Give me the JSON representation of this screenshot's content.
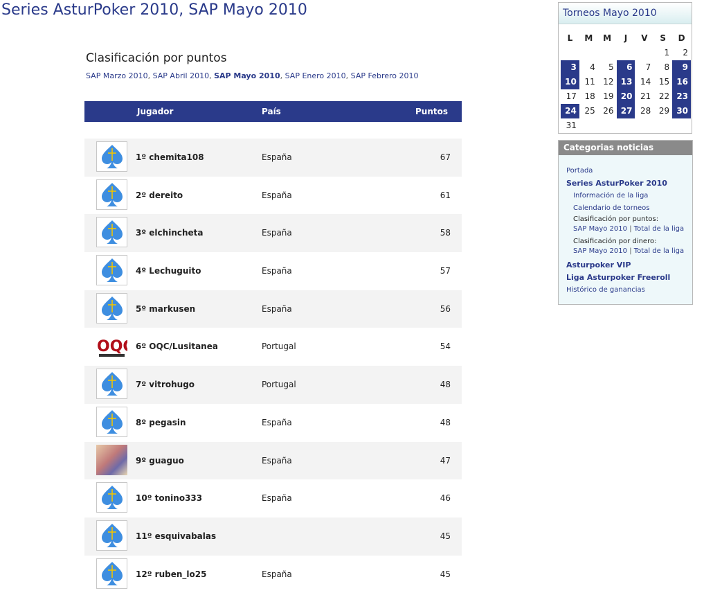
{
  "page_title": "Series AsturPoker 2010, SAP Mayo 2010",
  "section": {
    "title": "Clasificación por puntos",
    "links": [
      {
        "label": "SAP Marzo 2010",
        "current": false
      },
      {
        "label": "SAP Abril 2010",
        "current": false
      },
      {
        "label": "SAP Mayo 2010",
        "current": true
      },
      {
        "label": "SAP Enero 2010",
        "current": false
      },
      {
        "label": "SAP Febrero 2010",
        "current": false
      }
    ],
    "link_separator": ", "
  },
  "table": {
    "headers": {
      "player": "Jugador",
      "country": "País",
      "points": "Puntos"
    },
    "rows": [
      {
        "name": "1º chemita108",
        "country": "España",
        "points": "67",
        "avatar": "spade-icon"
      },
      {
        "name": "2º dereito",
        "country": "España",
        "points": "61",
        "avatar": "spade-icon"
      },
      {
        "name": "3º elchincheta",
        "country": "España",
        "points": "58",
        "avatar": "spade-icon"
      },
      {
        "name": "4º Lechuguito",
        "country": "España",
        "points": "57",
        "avatar": "spade-icon"
      },
      {
        "name": "5º markusen",
        "country": "España",
        "points": "56",
        "avatar": "spade-icon"
      },
      {
        "name": "6º OQC/Lusitanea",
        "country": "Portugal",
        "points": "54",
        "avatar": "oqc-logo"
      },
      {
        "name": "7º vitrohugo",
        "country": "Portugal",
        "points": "48",
        "avatar": "spade-icon"
      },
      {
        "name": "8º pegasin",
        "country": "España",
        "points": "48",
        "avatar": "spade-icon"
      },
      {
        "name": "9º guaguo",
        "country": "España",
        "points": "47",
        "avatar": "photo-avatar"
      },
      {
        "name": "10º tonino333",
        "country": "España",
        "points": "46",
        "avatar": "spade-icon"
      },
      {
        "name": "11º esquivabalas",
        "country": "",
        "points": "45",
        "avatar": "spade-icon"
      },
      {
        "name": "12º ruben_lo25",
        "country": "España",
        "points": "45",
        "avatar": "spade-icon"
      }
    ]
  },
  "calendar": {
    "title": "Torneos Mayo 2010",
    "weekdays": [
      "L",
      "M",
      "M",
      "J",
      "V",
      "S",
      "D"
    ],
    "weeks": [
      [
        {
          "d": ""
        },
        {
          "d": ""
        },
        {
          "d": ""
        },
        {
          "d": ""
        },
        {
          "d": ""
        },
        {
          "d": "1"
        },
        {
          "d": "2"
        }
      ],
      [
        {
          "d": "3",
          "hi": true
        },
        {
          "d": "4"
        },
        {
          "d": "5"
        },
        {
          "d": "6",
          "hi": true
        },
        {
          "d": "7"
        },
        {
          "d": "8"
        },
        {
          "d": "9",
          "hi": true
        }
      ],
      [
        {
          "d": "10",
          "hi": true
        },
        {
          "d": "11"
        },
        {
          "d": "12"
        },
        {
          "d": "13",
          "hi": true
        },
        {
          "d": "14"
        },
        {
          "d": "15"
        },
        {
          "d": "16",
          "hi": true
        }
      ],
      [
        {
          "d": "17"
        },
        {
          "d": "18"
        },
        {
          "d": "19"
        },
        {
          "d": "20",
          "hi": true
        },
        {
          "d": "21"
        },
        {
          "d": "22"
        },
        {
          "d": "23",
          "hi": true
        }
      ],
      [
        {
          "d": "24",
          "hi": true
        },
        {
          "d": "25"
        },
        {
          "d": "26"
        },
        {
          "d": "27",
          "hi": true
        },
        {
          "d": "28"
        },
        {
          "d": "29"
        },
        {
          "d": "30",
          "hi": true
        }
      ],
      [
        {
          "d": "31"
        },
        {
          "d": ""
        },
        {
          "d": ""
        },
        {
          "d": ""
        },
        {
          "d": ""
        },
        {
          "d": ""
        },
        {
          "d": ""
        }
      ]
    ]
  },
  "categories": {
    "title": "Categorias noticias",
    "portada": "Portada",
    "series": "Series AsturPoker 2010",
    "info_liga": "Información de la liga",
    "calendario": "Calendario de torneos",
    "clasif_puntos": "Clasificación por puntos:",
    "clasif_dinero": "Clasificación por dinero:",
    "sap_mayo": "SAP Mayo 2010",
    "total_liga": "Total de la liga",
    "sep": " | ",
    "vip": "Asturpoker VIP",
    "freeroll": "Liga Asturpoker Freeroll",
    "historico": "Histórico de ganancias"
  },
  "colors": {
    "accent": "#2a3a8a",
    "row_alt": "#f3f3f3"
  }
}
